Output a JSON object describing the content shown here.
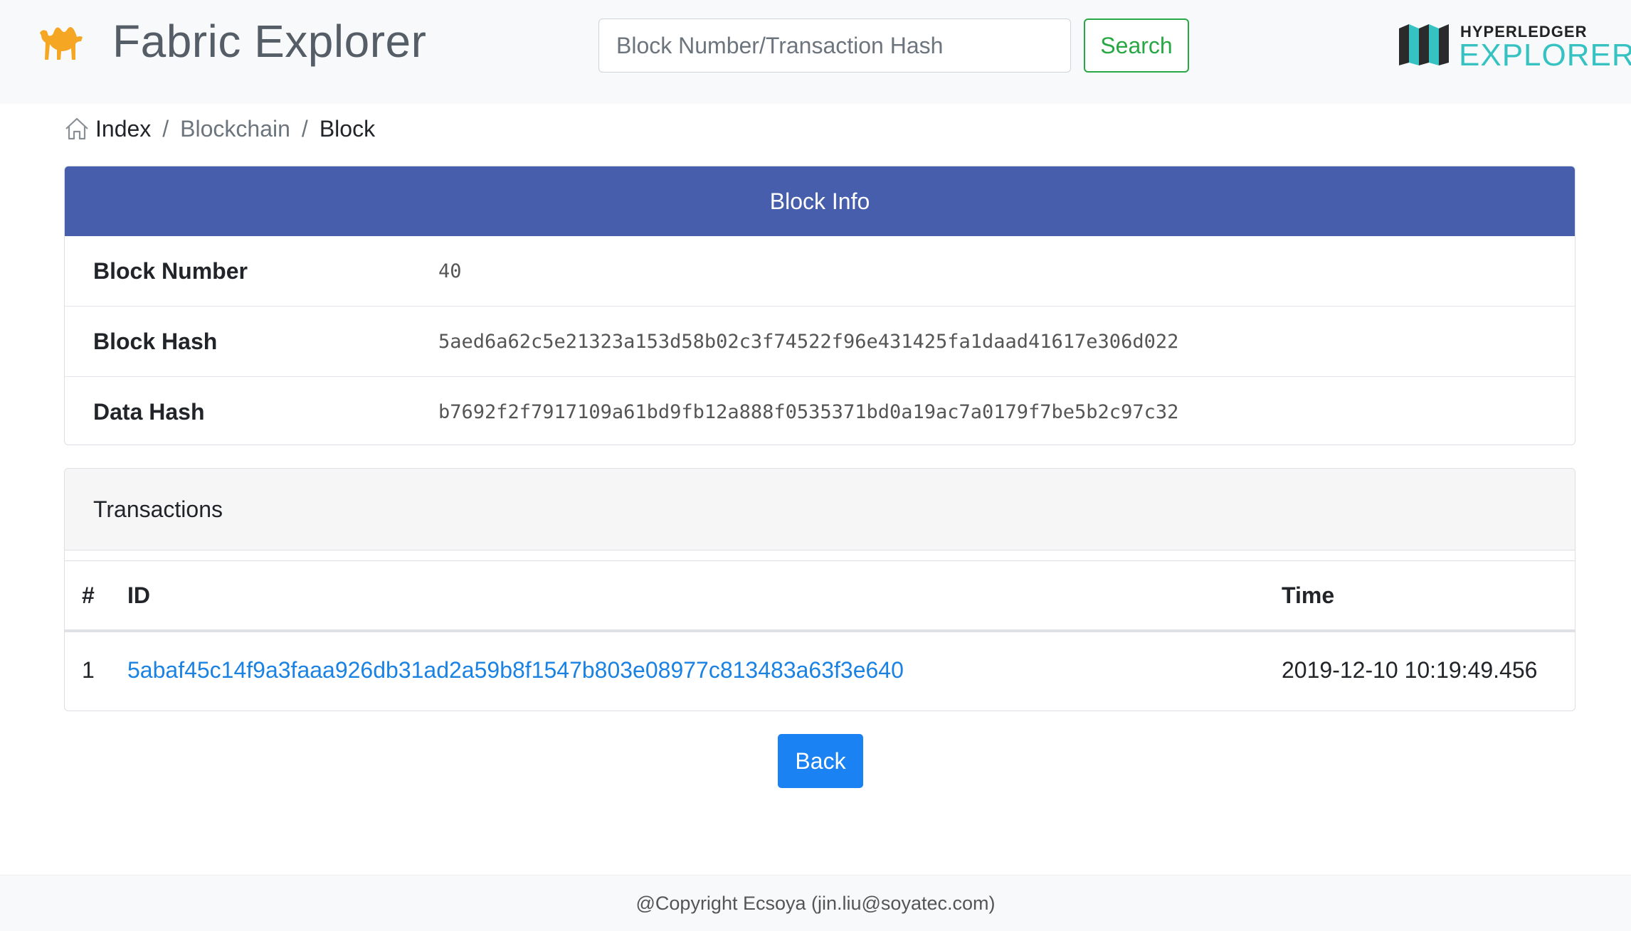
{
  "header": {
    "app_title": "Fabric Explorer",
    "logo_icon": "camel-icon",
    "search_placeholder": "Block Number/Transaction Hash",
    "search_value": "",
    "search_label": "Search",
    "brand_top": "HYPERLEDGER",
    "brand_bottom": "EXPLORER"
  },
  "breadcrumb": {
    "home_icon": "home-icon",
    "items": [
      "Index",
      "Blockchain",
      "Block"
    ],
    "separator": "/"
  },
  "block_info": {
    "title": "Block Info",
    "rows": [
      {
        "label": "Block Number",
        "value": "40"
      },
      {
        "label": "Block Hash",
        "value": "5aed6a62c5e21323a153d58b02c3f74522f96e431425fa1daad41617e306d022"
      },
      {
        "label": "Data Hash",
        "value": "b7692f2f7917109a61bd9fb12a888f0535371bd0a19ac7a0179f7be5b2c97c32"
      }
    ]
  },
  "transactions": {
    "title": "Transactions",
    "columns": [
      "#",
      "ID",
      "Time"
    ],
    "rows": [
      {
        "num": "1",
        "id": "5abaf45c14f9a3faaa926db31ad2a59b8f1547b803e08977c813483a63f3e640",
        "time": "2019-12-10 10:19:49.456"
      }
    ]
  },
  "back_label": "Back",
  "footer": {
    "text": "@Copyright Ecsoya (jin.liu@soyatec.com)"
  },
  "colors": {
    "header_bg": "#f8f9fa",
    "card_header": "#475ead",
    "success": "#28a745",
    "primary": "#1a82f2",
    "link": "#1a82e2",
    "brand_teal": "#36c2c2"
  }
}
